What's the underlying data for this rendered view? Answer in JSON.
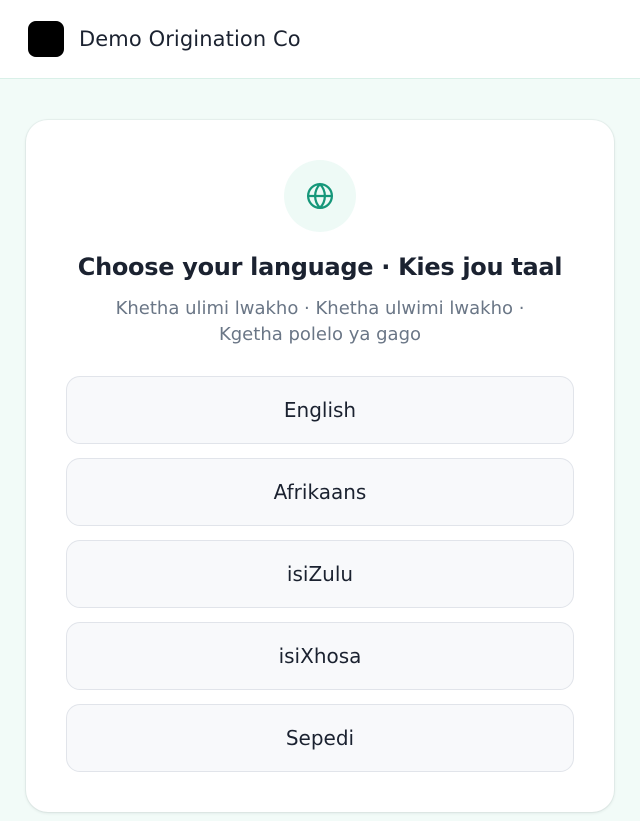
{
  "header": {
    "brand_name": "Demo Origination Co"
  },
  "card": {
    "icon": "globe-icon",
    "title": "Choose your language · Kies jou taal",
    "subtitle": "Khetha ulimi lwakho · Khetha ulwimi lwakho · Kgetha polelo ya gago",
    "options": [
      {
        "label": "English"
      },
      {
        "label": "Afrikaans"
      },
      {
        "label": "isiZulu"
      },
      {
        "label": "isiXhosa"
      },
      {
        "label": "Sepedi"
      }
    ]
  },
  "colors": {
    "accent": "#16977a",
    "background": "#f2fbf8",
    "text": "#1b2230",
    "muted_text": "#6a7686"
  }
}
